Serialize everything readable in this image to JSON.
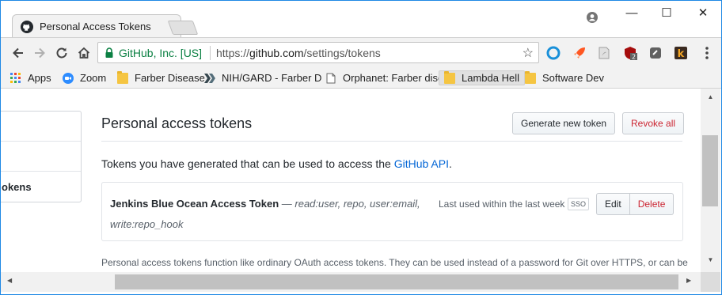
{
  "browser": {
    "tab_title": "Personal Access Tokens",
    "tab_close": "×",
    "window_controls": {
      "minimize": "—",
      "maximize": "☐",
      "close": "✕"
    },
    "ev_label": "GitHub, Inc. [US]",
    "url_protocol": "https://",
    "url_domain": "github.com",
    "url_path": "/settings/tokens",
    "star": "☆",
    "extensions": [
      "blue-circle-icon",
      "rocket-icon",
      "pdf-icon",
      "ublock-icon",
      "extension-icon",
      "k-icon"
    ],
    "ublock_badge": "2"
  },
  "bookmarks": [
    {
      "label": "Apps",
      "icon": "apps-grid-icon"
    },
    {
      "label": "Zoom",
      "icon": "zoom-icon"
    },
    {
      "label": "Farber Disease",
      "icon": "folder-icon"
    },
    {
      "label": "NIH/GARD - Farber D",
      "icon": "gard-icon"
    },
    {
      "label": "Orphanet: Farber dise",
      "icon": "page-icon"
    },
    {
      "label": "Lambda Hell",
      "icon": "folder-icon"
    },
    {
      "label": "Software Dev",
      "icon": "folder-icon"
    }
  ],
  "sidenav": {
    "selected_label": "okens"
  },
  "page": {
    "title": "Personal access tokens",
    "generate_button": "Generate new token",
    "revoke_all_button": "Revoke all",
    "desc_prefix": "Tokens you have generated that can be used to access the ",
    "desc_link": "GitHub API",
    "desc_suffix": "."
  },
  "token": {
    "name": "Jenkins Blue Ocean Access Token",
    "dash": " — ",
    "scopes_line1": "read:user, repo, user:email,",
    "scopes_line2": "write:repo_hook",
    "last_used": "Last used within the last week",
    "sso_label": "SSO",
    "edit_button": "Edit",
    "delete_button": "Delete"
  },
  "footnote": "Personal access tokens function like ordinary OAuth access tokens. They can be used instead of a password for Git over HTTPS, or can be",
  "colors": {
    "link": "#0366d6",
    "danger": "#cb2431",
    "ev_green": "#0b8043",
    "window_border": "#1e88e5"
  }
}
